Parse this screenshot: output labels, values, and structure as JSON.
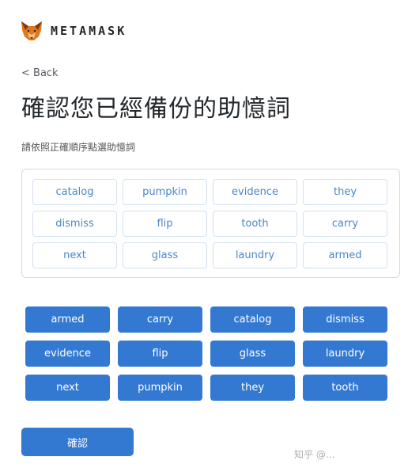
{
  "header": {
    "brand": "METAMASK",
    "logo_icon": "metamask-fox-icon"
  },
  "nav": {
    "back_label": "< Back"
  },
  "page": {
    "title": "確認您已經備份的助憶詞",
    "subtitle": "請依照正確順序點選助憶詞"
  },
  "selected_words": [
    "catalog",
    "pumpkin",
    "evidence",
    "they",
    "dismiss",
    "flip",
    "tooth",
    "carry",
    "next",
    "glass",
    "laundry",
    "armed"
  ],
  "word_pool": [
    "armed",
    "carry",
    "catalog",
    "dismiss",
    "evidence",
    "flip",
    "glass",
    "laundry",
    "next",
    "pumpkin",
    "they",
    "tooth"
  ],
  "actions": {
    "confirm_label": "確認"
  },
  "watermark": "知乎 @...",
  "colors": {
    "accent": "#3479d1",
    "slot_text": "#4a86c8",
    "slot_border": "#d2e1f2"
  }
}
